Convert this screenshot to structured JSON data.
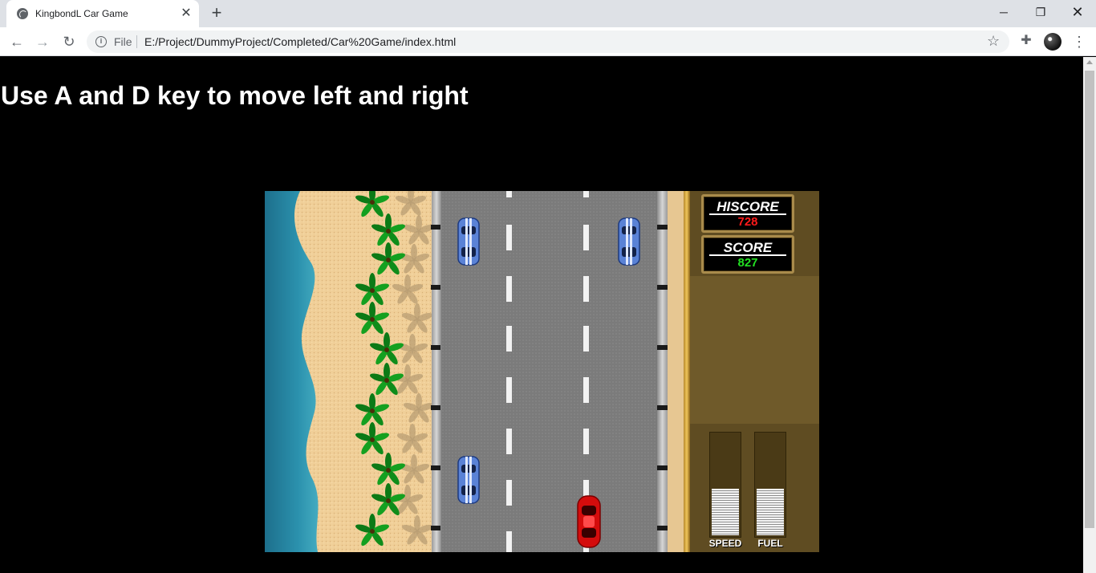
{
  "browser": {
    "tab_title": "KingbondL Car Game",
    "tab_close": "✕",
    "new_tab": "+",
    "scheme_label": "File",
    "url": "E:/Project/DummyProject/Completed/Car%20Game/index.html",
    "window_controls": {
      "minimize": "─",
      "maximize": "❐",
      "close": "✕"
    },
    "nav": {
      "back": "←",
      "forward": "→",
      "reload": "↻"
    },
    "icons": [
      "globe-icon",
      "info-icon",
      "star-icon",
      "puzzle-icon",
      "avatar",
      "kebab-menu-icon"
    ]
  },
  "page": {
    "headline": "Use A and D key to move left and right"
  },
  "game": {
    "hiscore_label": "HISCORE",
    "hiscore_value": "728",
    "score_label": "SCORE",
    "score_value": "827",
    "speed_label": "SPEED",
    "fuel_label": "FUEL",
    "speed_level": 0.45,
    "fuel_level": 0.45,
    "colors": {
      "hiscore": "#ff1a1a",
      "score": "#22e022",
      "player_car": "#d40c0c",
      "enemy_car": "#5a82d6"
    }
  }
}
